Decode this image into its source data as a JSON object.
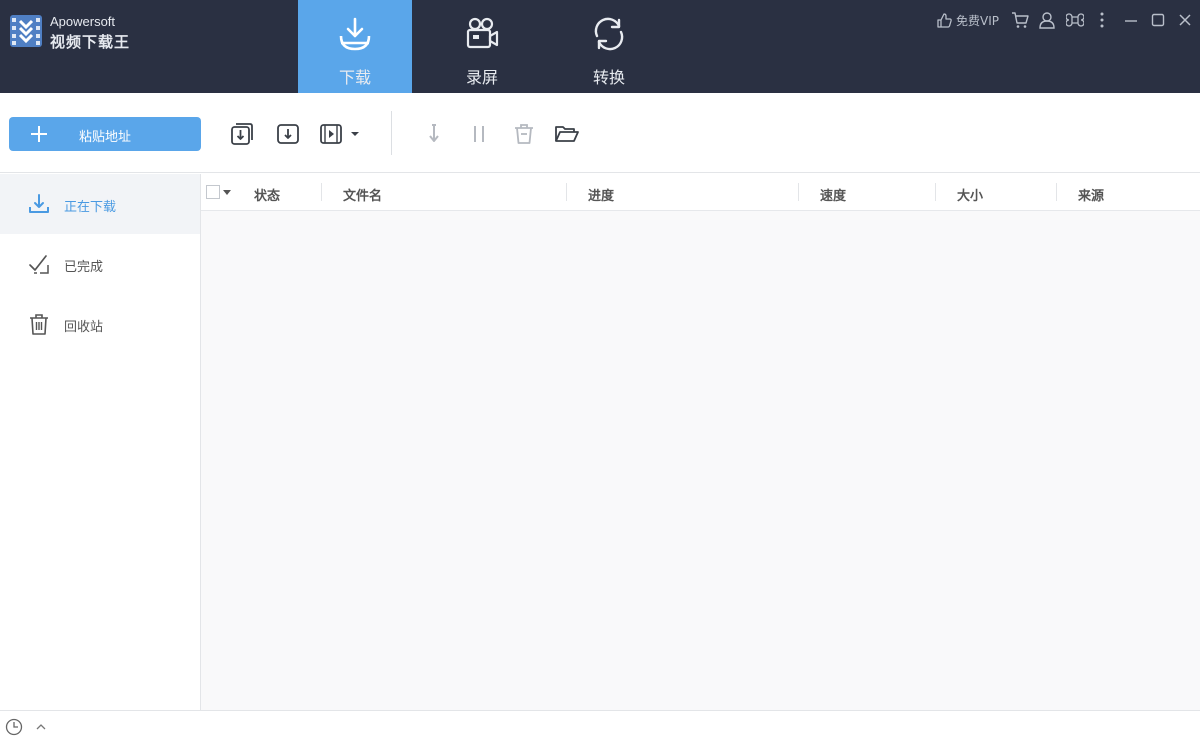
{
  "brand": {
    "company": "Apowersoft",
    "product": "视频下载王"
  },
  "nav": {
    "tabs": [
      {
        "label": "下载",
        "icon": "download-tray-icon",
        "active": true
      },
      {
        "label": "录屏",
        "icon": "video-camera-icon",
        "active": false
      },
      {
        "label": "转换",
        "icon": "convert-cycle-icon",
        "active": false
      }
    ]
  },
  "window": {
    "vip_label": "免费VIP"
  },
  "toolbar": {
    "paste_label": "粘贴地址"
  },
  "sidebar": {
    "items": [
      {
        "label": "正在下载",
        "icon": "download-icon",
        "active": true
      },
      {
        "label": "已完成",
        "icon": "check-icon",
        "active": false
      },
      {
        "label": "回收站",
        "icon": "trash-icon",
        "active": false
      }
    ]
  },
  "table": {
    "columns": [
      "状态",
      "文件名",
      "进度",
      "速度",
      "大小",
      "来源"
    ],
    "rows": []
  },
  "colors": {
    "titlebar": "#2a3042",
    "accent": "#5aa6ea",
    "active_text": "#4a9ae2"
  }
}
